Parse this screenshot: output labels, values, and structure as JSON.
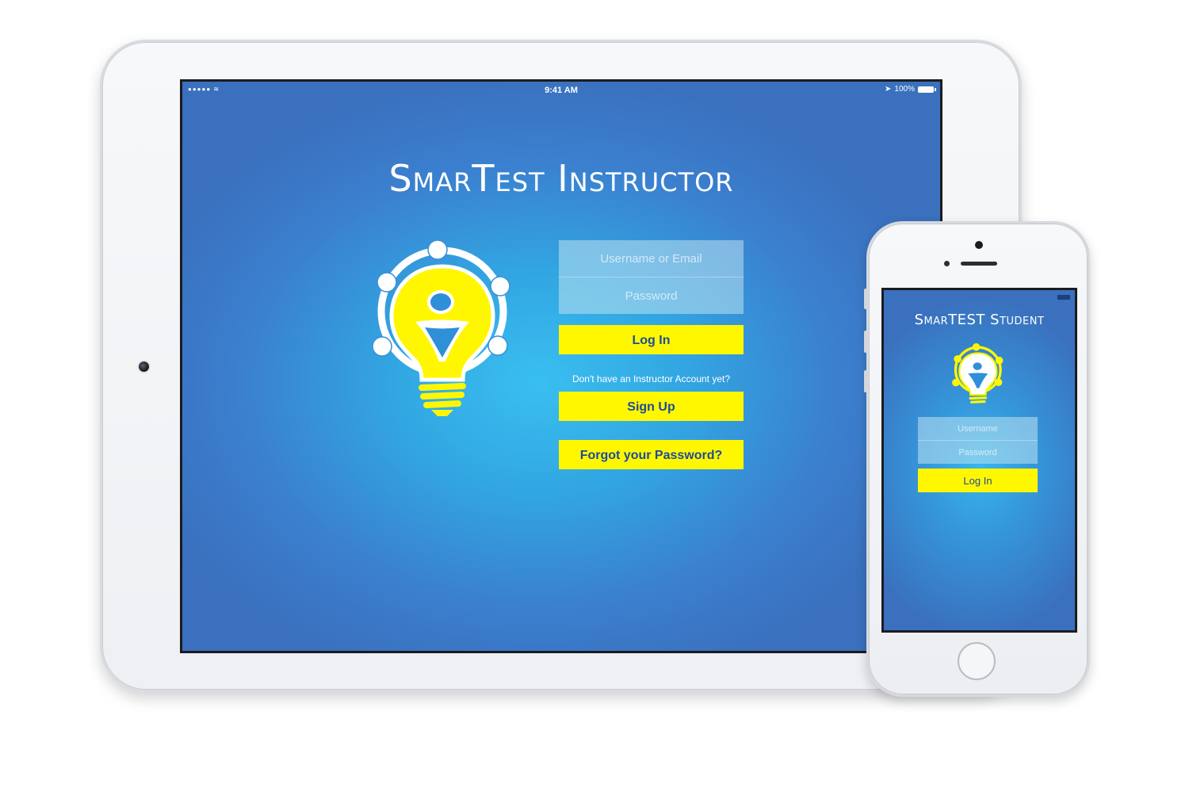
{
  "ipad": {
    "status_bar": {
      "signal": "●●●●● ≋",
      "time": "9:41 AM",
      "battery_text": "100%"
    },
    "app_title": "SmarTest Instructor",
    "form": {
      "username_placeholder": "Username or Email",
      "password_placeholder": "Password",
      "login_label": "Log In",
      "signup_prompt": "Don't have an Instructor Account yet?",
      "signup_label": "Sign Up",
      "forgot_label": "Forgot your Password?"
    }
  },
  "iphone": {
    "app_title": "SmarTEST Student",
    "form": {
      "username_placeholder": "Username",
      "password_placeholder": "Password",
      "login_label": "Log In"
    }
  },
  "colors": {
    "button_yellow": "#fff700",
    "button_text": "#1d4c9a",
    "screen_blue": "#3a70bd",
    "screen_glow": "#39bff0"
  },
  "icons": [
    "lightbulb-logo-icon",
    "location-arrow-icon",
    "battery-icon",
    "wifi-icon"
  ]
}
